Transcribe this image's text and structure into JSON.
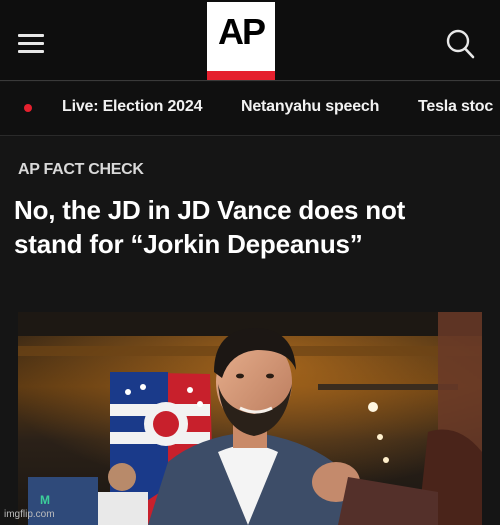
{
  "header": {
    "logo_text": "AP",
    "menu_icon": "hamburger-menu-icon",
    "search_icon": "search-icon",
    "logo_accent": "#e5202e"
  },
  "nav": {
    "items": [
      {
        "label": "Live: Election 2024",
        "live": true
      },
      {
        "label": "Netanyahu speech"
      },
      {
        "label": "Tesla stoc"
      }
    ]
  },
  "article": {
    "kicker": "AP FACT CHECK",
    "headline_line1": "No, the JD in JD Vance does not",
    "headline_line2": "stand for “Jorkin Depeanus”"
  },
  "watermark": "imgflip.com"
}
